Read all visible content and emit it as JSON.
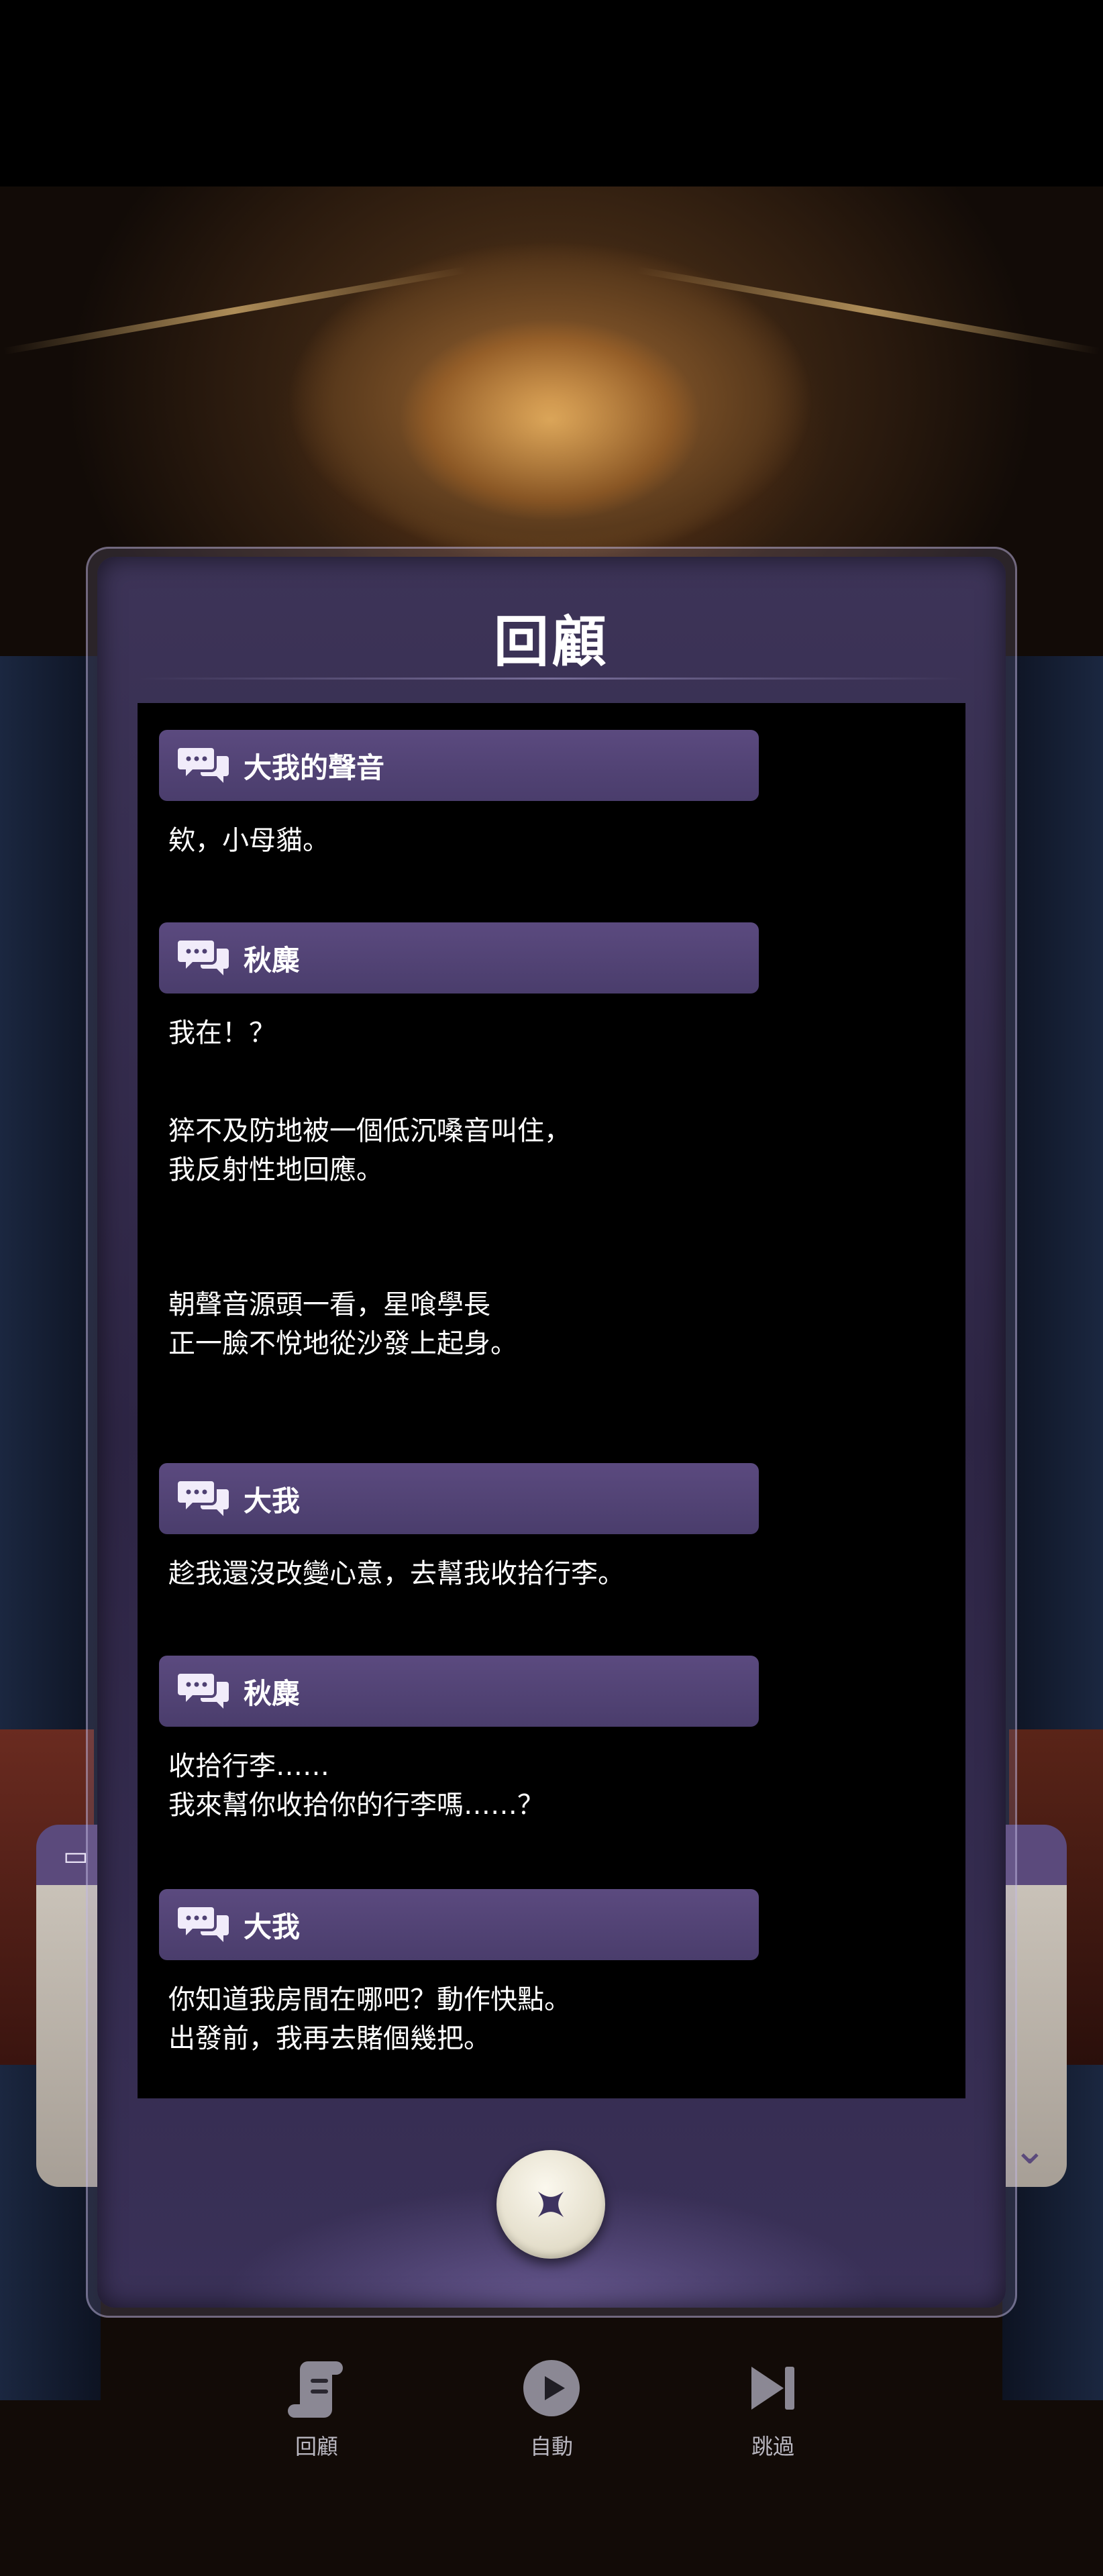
{
  "panel": {
    "title": "回顧",
    "entries": [
      {
        "speaker": "大我的聲音",
        "lines": [
          "欸，小母貓。"
        ]
      },
      {
        "speaker": "秋麋",
        "lines": [
          "我在！？",
          "猝不及防地被一個低沉嗓音叫住，\n我反射性地回應。",
          "朝聲音源頭一看，星喰學長\n正一臉不悅地從沙發上起身。"
        ]
      },
      {
        "speaker": "大我",
        "lines": [
          "趁我還沒改變心意，去幫我收拾行李。"
        ]
      },
      {
        "speaker": "秋麋",
        "lines": [
          "收拾行李……\n我來幫你收拾你的行李嗎……？"
        ]
      },
      {
        "speaker": "大我",
        "lines": [
          "你知道我房間在哪吧？動作快點。\n出發前，我再去賭個幾把。"
        ]
      }
    ],
    "close_icon": "close-star-icon"
  },
  "controls": [
    {
      "label": "回顧",
      "icon": "scroll-icon"
    },
    {
      "label": "自動",
      "icon": "play-icon"
    },
    {
      "label": "跳過",
      "icon": "skip-icon"
    }
  ],
  "colors": {
    "speaker_bar": "#4f4173",
    "panel_bg": "#2f2746",
    "log_bg": "#000000"
  }
}
